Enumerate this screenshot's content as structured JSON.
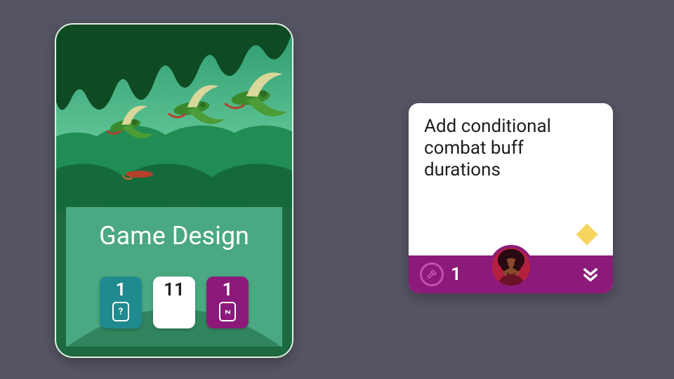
{
  "board": {
    "title": "Game Design",
    "stats": {
      "triage": {
        "count": 1,
        "icon": "?"
      },
      "active": {
        "count": 11
      },
      "snoozed": {
        "count": 1,
        "icon": "z"
      }
    }
  },
  "task": {
    "title": "Add conditional combat buff durations",
    "footer_count": 1
  },
  "colors": {
    "bg": "#545463",
    "board_green": "#4aa882",
    "task_accent": "#8c1a7a",
    "diamond": "#f5d560"
  }
}
